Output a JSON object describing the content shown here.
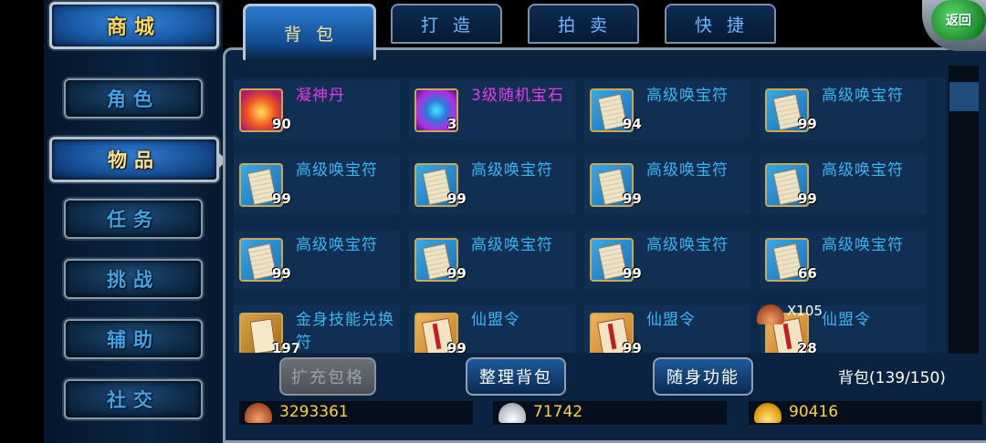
{
  "nav": {
    "shop": "商城",
    "items": [
      "角色",
      "物品",
      "任务",
      "挑战",
      "辅助",
      "社交"
    ],
    "active_index": 1
  },
  "tabs": [
    "背包",
    "打造",
    "拍卖",
    "快捷"
  ],
  "active_tab": "背包",
  "back_label": "返回",
  "inventory": [
    {
      "name": "凝神丹",
      "qty": "90",
      "icon": "pill-icon",
      "color": "magenta"
    },
    {
      "name": "3级随机宝石",
      "qty": "3",
      "icon": "gem-icon",
      "color": "magenta"
    },
    {
      "name": "高级唤宝符",
      "qty": "94",
      "icon": "scroll-icon",
      "color": "cyan"
    },
    {
      "name": "高级唤宝符",
      "qty": "99",
      "icon": "scroll-icon",
      "color": "cyan"
    },
    {
      "name": "高级唤宝符",
      "qty": "99",
      "icon": "scroll-icon",
      "color": "cyan"
    },
    {
      "name": "高级唤宝符",
      "qty": "99",
      "icon": "scroll-icon",
      "color": "cyan"
    },
    {
      "name": "高级唤宝符",
      "qty": "99",
      "icon": "scroll-icon",
      "color": "cyan"
    },
    {
      "name": "高级唤宝符",
      "qty": "99",
      "icon": "scroll-icon",
      "color": "cyan"
    },
    {
      "name": "高级唤宝符",
      "qty": "99",
      "icon": "scroll-icon",
      "color": "cyan"
    },
    {
      "name": "高级唤宝符",
      "qty": "99",
      "icon": "scroll-icon",
      "color": "cyan"
    },
    {
      "name": "高级唤宝符",
      "qty": "99",
      "icon": "scroll-icon",
      "color": "cyan"
    },
    {
      "name": "高级唤宝符",
      "qty": "66",
      "icon": "scroll-icon",
      "color": "cyan"
    },
    {
      "name": "金身技能兑换符",
      "qty": "197",
      "icon": "gold-icon",
      "color": "cyan"
    },
    {
      "name": "仙盟令",
      "qty": "99",
      "icon": "token-icon",
      "color": "cyan"
    },
    {
      "name": "仙盟令",
      "qty": "99",
      "icon": "token-icon",
      "color": "cyan"
    },
    {
      "name": "仙盟令",
      "qty": "28",
      "icon": "token-icon",
      "color": "cyan"
    }
  ],
  "overlay": {
    "text": "X105"
  },
  "buttons": {
    "expand": "扩充包格",
    "sort": "整理背包",
    "portable": "随身功能"
  },
  "bag_count": "背包(139/150)",
  "currency": [
    {
      "icon": "bronze-coin-icon",
      "amount": "3293361"
    },
    {
      "icon": "silver-coin-icon",
      "amount": "71742"
    },
    {
      "icon": "gold-coin-icon",
      "amount": "90416"
    }
  ]
}
